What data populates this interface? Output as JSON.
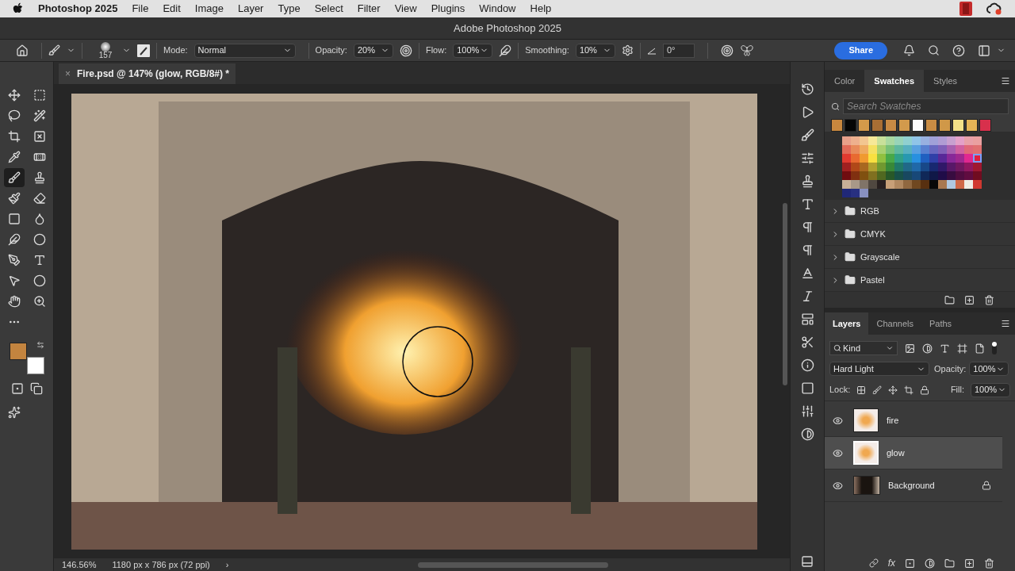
{
  "menu_bar": {
    "app": "Photoshop 2025",
    "items": [
      "File",
      "Edit",
      "Image",
      "Layer",
      "Type",
      "Select",
      "Filter",
      "View",
      "Plugins",
      "Window",
      "Help"
    ]
  },
  "window": {
    "title": "Adobe Photoshop 2025"
  },
  "options_bar": {
    "brush_size": "157",
    "mode_label": "Mode:",
    "mode": "Normal",
    "opacity_label": "Opacity:",
    "opacity": "20%",
    "flow_label": "Flow:",
    "flow": "100%",
    "smoothing_label": "Smoothing:",
    "smoothing": "10%",
    "angle": "0°",
    "share": "Share"
  },
  "document_tab": {
    "close": "×",
    "title": "Fire.psd @ 147% (glow, RGB/8#) *"
  },
  "tools": [
    {
      "selected": false
    },
    {
      "selected": false
    },
    {
      "selected": false
    },
    {
      "selected": false
    },
    {
      "selected": false
    },
    {
      "selected": false
    },
    {
      "selected": false
    },
    {
      "selected": false
    },
    {
      "selected": true
    },
    {
      "selected": false
    },
    {
      "selected": false
    },
    {
      "selected": false
    },
    {
      "selected": false
    },
    {
      "selected": false
    },
    {
      "selected": false
    },
    {
      "selected": false
    },
    {
      "selected": false
    },
    {
      "selected": false
    },
    {
      "selected": false
    },
    {
      "selected": false
    },
    {
      "selected": false
    },
    {
      "selected": false
    },
    {
      "selected": false
    }
  ],
  "color_chips": [
    {
      "color": "#c3843f"
    },
    {
      "color": "#ffffff"
    }
  ],
  "status_bar": {
    "zoom": "146.56%",
    "size": "1180 px x 786 px (72 ppi)",
    "more": "›"
  },
  "swatches_panel": {
    "tabs": [
      {
        "label": "Color",
        "selected": false
      },
      {
        "label": "Swatches",
        "selected": true
      },
      {
        "label": "Styles",
        "selected": false
      }
    ],
    "search": {
      "placeholder": "Search Swatches"
    },
    "recent": [
      {
        "color": "#c8873e"
      },
      {
        "color": "#050505"
      },
      {
        "color": "#d49a4a"
      },
      {
        "color": "#a86e34"
      },
      {
        "color": "#c88a44"
      },
      {
        "color": "#d29a4c"
      },
      {
        "color": "#fcfcfc"
      },
      {
        "color": "#c98c44"
      },
      {
        "color": "#d09848"
      },
      {
        "color": "#f2e088"
      },
      {
        "color": "#e4b456"
      },
      {
        "color": "#d8304c"
      }
    ],
    "grid": [
      [
        {
          "color": "#e8a08a",
          "selected": false
        },
        {
          "color": "#eeb08e",
          "selected": false
        },
        {
          "color": "#f2c690",
          "selected": false
        },
        {
          "color": "#f6e898",
          "selected": false
        },
        {
          "color": "#c8e09a",
          "selected": false
        },
        {
          "color": "#a8d8a0",
          "selected": false
        },
        {
          "color": "#98d4b8",
          "selected": false
        },
        {
          "color": "#90d0d0",
          "selected": false
        },
        {
          "color": "#90c4e8",
          "selected": false
        },
        {
          "color": "#98b0e0",
          "selected": false
        },
        {
          "color": "#a0a0d8",
          "selected": false
        },
        {
          "color": "#b09cd4",
          "selected": false
        },
        {
          "color": "#c8a0d0",
          "selected": false
        },
        {
          "color": "#e4a0c8",
          "selected": false
        },
        {
          "color": "#e8a0a8",
          "selected": false
        },
        {
          "color": "#eaa0a0",
          "selected": false
        }
      ],
      [
        {
          "color": "#e06a58",
          "selected": false
        },
        {
          "color": "#e88a5a",
          "selected": false
        },
        {
          "color": "#eeaa60",
          "selected": false
        },
        {
          "color": "#f4e060",
          "selected": false
        },
        {
          "color": "#a8d070",
          "selected": false
        },
        {
          "color": "#78c078",
          "selected": false
        },
        {
          "color": "#60b8a0",
          "selected": false
        },
        {
          "color": "#58b0c0",
          "selected": false
        },
        {
          "color": "#58a0e0",
          "selected": false
        },
        {
          "color": "#5880d0",
          "selected": false
        },
        {
          "color": "#6868c0",
          "selected": false
        },
        {
          "color": "#8060b8",
          "selected": false
        },
        {
          "color": "#a860b0",
          "selected": false
        },
        {
          "color": "#d060a0",
          "selected": false
        },
        {
          "color": "#e06878",
          "selected": false
        },
        {
          "color": "#e07070",
          "selected": false
        }
      ],
      [
        {
          "color": "#e03a30",
          "selected": false
        },
        {
          "color": "#e86a30",
          "selected": false
        },
        {
          "color": "#f09a30",
          "selected": false
        },
        {
          "color": "#f8e040",
          "selected": false
        },
        {
          "color": "#90c040",
          "selected": false
        },
        {
          "color": "#48a848",
          "selected": false
        },
        {
          "color": "#30a088",
          "selected": false
        },
        {
          "color": "#2898b0",
          "selected": false
        },
        {
          "color": "#2890e0",
          "selected": false
        },
        {
          "color": "#2060c0",
          "selected": false
        },
        {
          "color": "#3040a8",
          "selected": false
        },
        {
          "color": "#582898",
          "selected": false
        },
        {
          "color": "#882898",
          "selected": false
        },
        {
          "color": "#a02890",
          "selected": false
        },
        {
          "color": "#e02890",
          "selected": false
        },
        {
          "color": "#e02040",
          "selected": true
        }
      ],
      [
        {
          "color": "#a02020",
          "selected": false
        },
        {
          "color": "#b04818",
          "selected": false
        },
        {
          "color": "#a86820",
          "selected": false
        },
        {
          "color": "#b0a030",
          "selected": false
        },
        {
          "color": "#709830",
          "selected": false
        },
        {
          "color": "#388838",
          "selected": false
        },
        {
          "color": "#207868",
          "selected": false
        },
        {
          "color": "#206888",
          "selected": false
        },
        {
          "color": "#2068a8",
          "selected": false
        },
        {
          "color": "#184888",
          "selected": false
        },
        {
          "color": "#182870",
          "selected": false
        },
        {
          "color": "#301868",
          "selected": false
        },
        {
          "color": "#581868",
          "selected": false
        },
        {
          "color": "#701860",
          "selected": false
        },
        {
          "color": "#901860",
          "selected": false
        },
        {
          "color": "#a01830",
          "selected": false
        }
      ],
      [
        {
          "color": "#700c10",
          "selected": false
        },
        {
          "color": "#803010",
          "selected": false
        },
        {
          "color": "#805010",
          "selected": false
        },
        {
          "color": "#807020",
          "selected": false
        },
        {
          "color": "#506820",
          "selected": false
        },
        {
          "color": "#285828",
          "selected": false
        },
        {
          "color": "#185048",
          "selected": false
        },
        {
          "color": "#184860",
          "selected": false
        },
        {
          "color": "#184878",
          "selected": false
        },
        {
          "color": "#102858",
          "selected": false
        },
        {
          "color": "#101848",
          "selected": false
        },
        {
          "color": "#200c48",
          "selected": false
        },
        {
          "color": "#380c40",
          "selected": false
        },
        {
          "color": "#500c40",
          "selected": false
        },
        {
          "color": "#600c40",
          "selected": false
        },
        {
          "color": "#700c20",
          "selected": false
        }
      ],
      [
        {
          "color": "#c8b098",
          "selected": false
        },
        {
          "color": "#a89888",
          "selected": false
        },
        {
          "color": "#807468",
          "selected": false
        },
        {
          "color": "#504840",
          "selected": false
        },
        {
          "color": "#282020",
          "selected": false
        },
        {
          "color": "#c8a078",
          "selected": false
        },
        {
          "color": "#b08860",
          "selected": false
        },
        {
          "color": "#906840",
          "selected": false
        },
        {
          "color": "#704820",
          "selected": false
        },
        {
          "color": "#583010",
          "selected": false
        },
        {
          "color": "#080808",
          "selected": false
        },
        {
          "color": "#a87850",
          "selected": false
        },
        {
          "color": "#b0c8e0",
          "selected": false
        },
        {
          "color": "#d06848",
          "selected": false
        },
        {
          "color": "#f0ece4",
          "selected": false
        },
        {
          "color": "#d03830",
          "selected": false
        }
      ],
      [
        {
          "color": "#202878",
          "selected": false
        },
        {
          "color": "#283080",
          "selected": false
        },
        {
          "color": "#8890c0",
          "selected": false
        }
      ]
    ],
    "groups": [
      {
        "name": "RGB",
        "expanded": false
      },
      {
        "name": "CMYK",
        "expanded": false
      },
      {
        "name": "Grayscale",
        "expanded": false
      },
      {
        "name": "Pastel",
        "expanded": false
      }
    ]
  },
  "layers_panel": {
    "tabs": [
      {
        "label": "Layers",
        "selected": true
      },
      {
        "label": "Channels",
        "selected": false
      },
      {
        "label": "Paths",
        "selected": false
      }
    ],
    "filter": "Kind",
    "blend_mode": "Hard Light",
    "opacity_label": "Opacity:",
    "opacity": "100%",
    "lock_label": "Lock:",
    "fill_label": "Fill:",
    "fill": "100%",
    "layers": [
      {
        "name": "fire",
        "visible": true,
        "selected": false,
        "locked": false,
        "kind": "transparent"
      },
      {
        "name": "glow",
        "visible": true,
        "selected": true,
        "locked": false,
        "kind": "transparent"
      },
      {
        "name": "Background",
        "visible": true,
        "selected": false,
        "locked": true,
        "kind": "photo"
      }
    ],
    "footer_fx": "fx"
  }
}
